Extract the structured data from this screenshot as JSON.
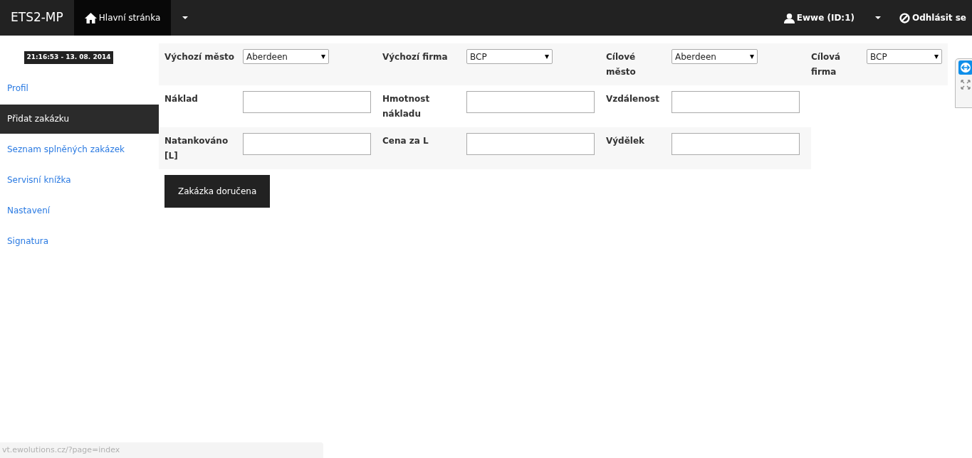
{
  "navbar": {
    "brand": "ETS2-MP",
    "tabs": [
      {
        "label": "Hlavní stránka",
        "selected": true
      }
    ],
    "user": "Ewwe (ID:1)",
    "logout": "Odhlásit se"
  },
  "sidebar": {
    "clock": "21:16:53 - 13. 08. 2014",
    "items": [
      {
        "label": "Profil",
        "selected": false
      },
      {
        "label": "Přidat zakázku",
        "selected": true
      },
      {
        "label": "Seznam splněných zakázek",
        "selected": false
      },
      {
        "label": "Servisní knížka",
        "selected": false
      },
      {
        "label": "Nastavení",
        "selected": false
      },
      {
        "label": "Signatura",
        "selected": false
      }
    ]
  },
  "form": {
    "rows": [
      [
        {
          "label": "Výchozí město",
          "kind": "select",
          "value": "Aberdeen"
        },
        {
          "label": "Výchozí firma",
          "kind": "select",
          "value": "BCP"
        },
        {
          "label": "Cílové město",
          "kind": "select",
          "value": "Aberdeen"
        },
        {
          "label": "Cílová firma",
          "kind": "select",
          "value": "BCP"
        }
      ],
      [
        {
          "label": "Náklad",
          "kind": "input"
        },
        {
          "label": "Hmotnost nákladu",
          "kind": "input"
        },
        {
          "label": "Vzdálenost",
          "kind": "input"
        }
      ],
      [
        {
          "label": "Natankováno [L]",
          "kind": "input"
        },
        {
          "label": "Cena za L",
          "kind": "input"
        },
        {
          "label": "Výdělek",
          "kind": "input"
        }
      ]
    ],
    "submit": "Zakázka doručena"
  },
  "status_bar": {
    "url": "vt.ewolutions.cz/?page=index"
  }
}
